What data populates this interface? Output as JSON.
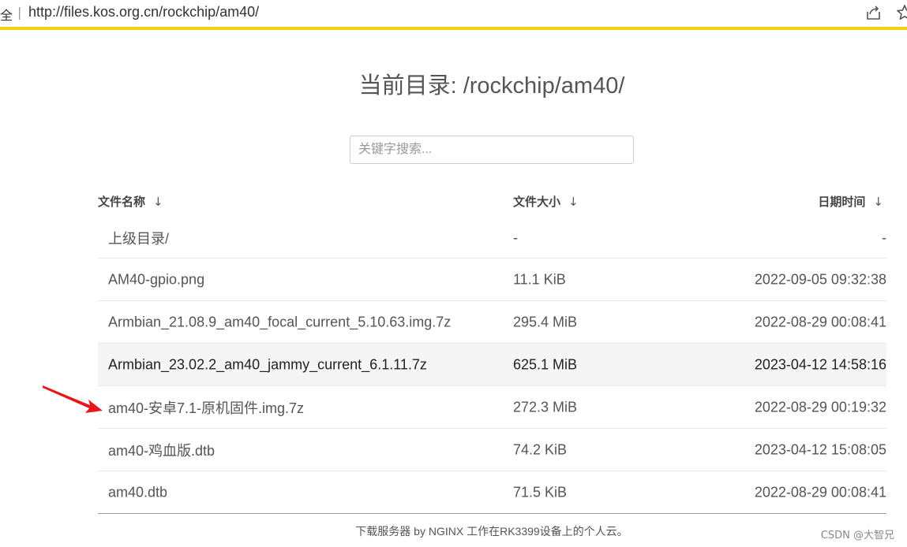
{
  "browser": {
    "prefix": "全",
    "separator": "|",
    "url": "http://files.kos.org.cn/rockchip/am40/",
    "share_icon": "share-icon",
    "star_icon": "star-icon",
    "accent_color": "#f4cf0a"
  },
  "page": {
    "title": "当前目录: /rockchip/am40/",
    "search_placeholder": "关键字搜索..."
  },
  "table": {
    "headers": {
      "name": "文件名称",
      "size": "文件大小",
      "date": "日期时间",
      "sort_arrow": "↓"
    },
    "rows": [
      {
        "name": "上级目录/",
        "size": "-",
        "date": "-"
      },
      {
        "name": "AM40-gpio.png",
        "size": "11.1 KiB",
        "date": "2022-09-05 09:32:38"
      },
      {
        "name": "Armbian_21.08.9_am40_focal_current_5.10.63.img.7z",
        "size": "295.4 MiB",
        "date": "2022-08-29 00:08:41"
      },
      {
        "name": "Armbian_23.02.2_am40_jammy_current_6.1.11.7z",
        "size": "625.1 MiB",
        "date": "2023-04-12 14:58:16"
      },
      {
        "name": "am40-安卓7.1-原机固件.img.7z",
        "size": "272.3 MiB",
        "date": "2022-08-29 00:19:32"
      },
      {
        "name": "am40-鸡血版.dtb",
        "size": "74.2 KiB",
        "date": "2023-04-12 15:08:05"
      },
      {
        "name": "am40.dtb",
        "size": "71.5 KiB",
        "date": "2022-08-29 00:08:41"
      }
    ]
  },
  "footer": {
    "text": "下载服务器 by NGINX 工作在RK3399设备上的个人云。"
  },
  "watermark": "CSDN @大智兄",
  "annotation": {
    "icon": "red-arrow-icon",
    "color": "#e8161b"
  }
}
